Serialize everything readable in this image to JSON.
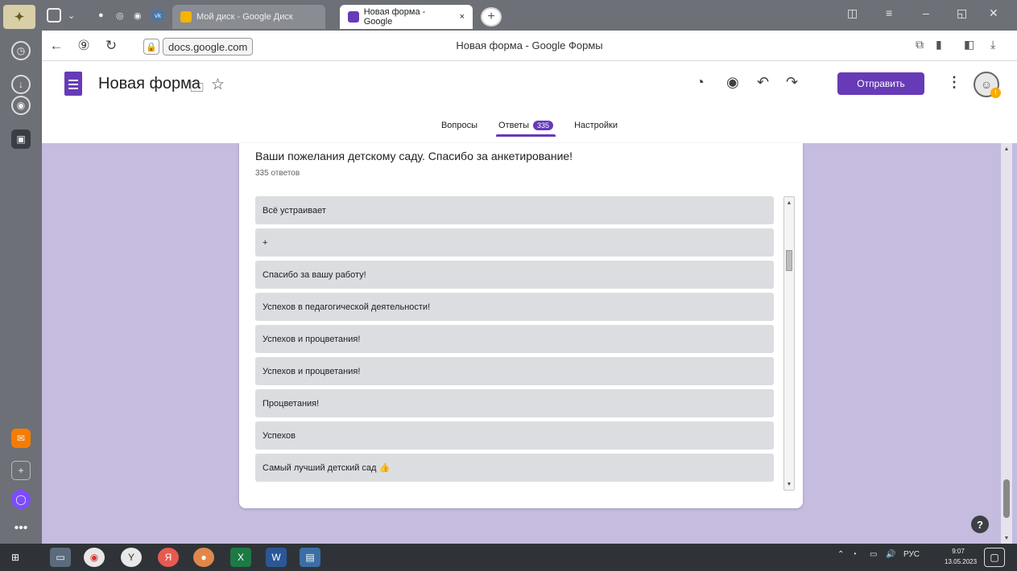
{
  "browser": {
    "tabs": [
      {
        "label": "Мой диск - Google Диск",
        "active": false
      },
      {
        "label": "Новая форма - Google",
        "active": true,
        "close": "×"
      }
    ],
    "new_tab": "+",
    "url": "docs.google.com",
    "page_title": "Новая форма - Google Формы"
  },
  "form": {
    "title": "Новая форма",
    "send_label": "Отправить",
    "tabs": {
      "questions": "Вопросы",
      "responses": "Ответы",
      "responses_count": "335",
      "settings": "Настройки"
    },
    "accent": "#673ab7",
    "background": "#c5bcdf"
  },
  "question": {
    "title": "Ваши пожелания детскому саду. Спасибо за анкетирование!",
    "count": "335 ответов",
    "answers": [
      {
        "text": "Всё устраивает"
      },
      {
        "text": "+"
      },
      {
        "text": "Спасибо за вашу работу!"
      },
      {
        "text": "Успехов в педагогической деятельности!"
      },
      {
        "text": "Успехов и процветания!"
      },
      {
        "text": "Успехов и процветания!"
      },
      {
        "text": "Процветания!"
      },
      {
        "text": "Успехов"
      },
      {
        "text": "Самый лучший детский сад 👍"
      }
    ]
  },
  "icons": {
    "palette": "palette-icon",
    "preview": "eye-icon",
    "undo": "undo-icon",
    "redo": "redo-icon",
    "more": "more-vert-icon",
    "folder": "folder-icon",
    "star": "star-icon",
    "help": "?"
  },
  "taskbar": {
    "tray_lang": "РУС",
    "time": "9:07",
    "date": "13.05.2023"
  }
}
